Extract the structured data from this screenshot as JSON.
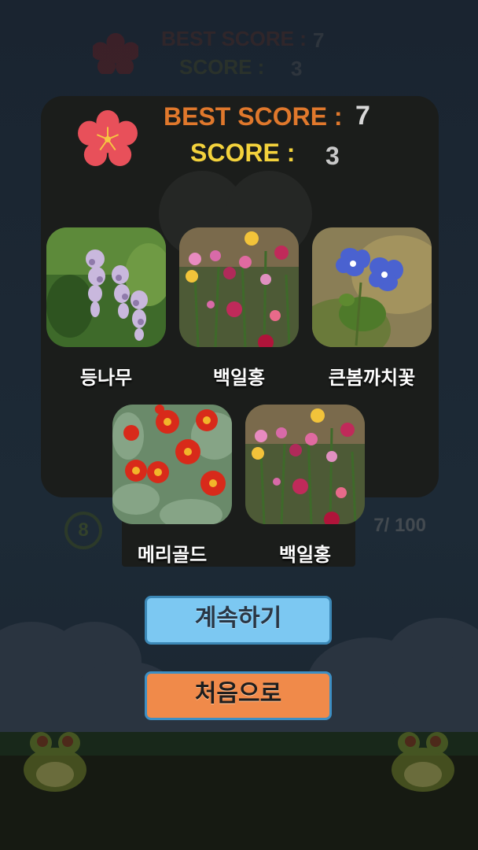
{
  "hud_background": {
    "best_score_label": "BEST SCORE :",
    "best_score_value": "7",
    "score_label": "SCORE :",
    "score_value": "3"
  },
  "result_panel": {
    "best_score_label": "BEST SCORE :",
    "best_score_value": "7",
    "score_label": "SCORE :",
    "score_value": "3",
    "colors": {
      "best": "#e0782c",
      "score": "#f3d23c",
      "panel": "#1b1d1b"
    },
    "flowers": [
      {
        "name": "등나무",
        "image": "wisteria-photo"
      },
      {
        "name": "백일홍",
        "image": "zinnia-photo"
      },
      {
        "name": "큰봄까치꽃",
        "image": "speedwell-photo"
      },
      {
        "name": "메리골드",
        "image": "marigold-photo"
      },
      {
        "name": "백일홍",
        "image": "zinnia-photo"
      }
    ]
  },
  "progress_background": {
    "timer": "8",
    "count": "7/ 100"
  },
  "buttons": {
    "continue_label": "계속하기",
    "home_label": "처음으로",
    "continue_color": "#7cc8f2",
    "home_color": "#f08a4a"
  }
}
